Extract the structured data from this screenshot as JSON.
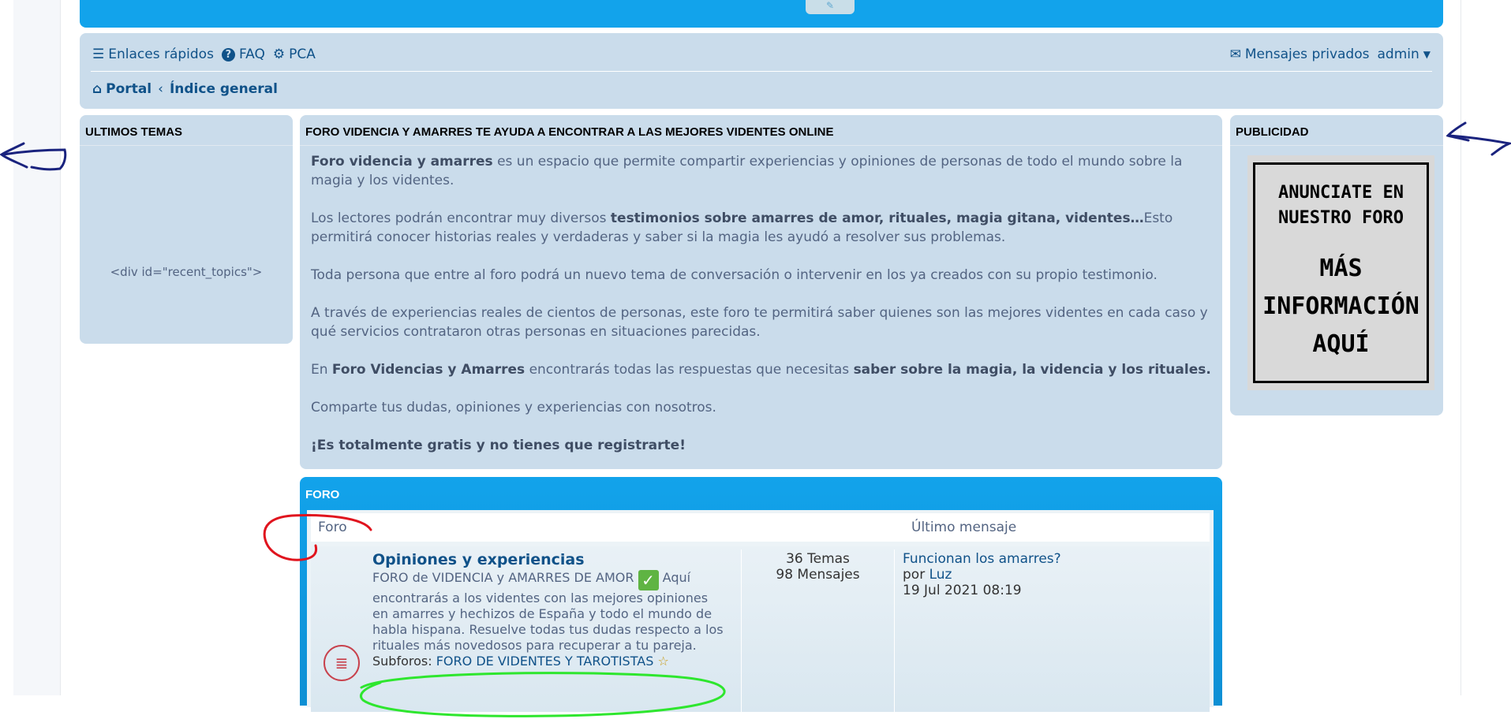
{
  "header": {
    "button_icon": "✎"
  },
  "navbar": {
    "quick_links": "Enlaces rápidos",
    "faq": "FAQ",
    "acp": "PCA",
    "private_messages": "Mensajes privados",
    "user": "admin",
    "breadcrumb_portal": "Portal",
    "breadcrumb_sep": "‹",
    "breadcrumb_index": "Índice general"
  },
  "left_panel": {
    "title": "ULTIMOS TEMAS",
    "content": "<div id=\"recent_topics\">"
  },
  "center_panel": {
    "title": "FORO VIDENCIA Y AMARRES TE AYUDA A ENCONTRAR A LAS MEJORES VIDENTES ONLINE",
    "p1_bold": "Foro videncia y amarres",
    "p1_rest": " es un espacio que permite compartir experiencias y opiniones de personas de todo el mundo sobre la magia y los videntes.",
    "p2_a": "Los lectores podrán encontrar muy diversos ",
    "p2_bold": "testimonios sobre amarres de amor, rituales, magia gitana, videntes…",
    "p2_b": "Esto permitirá conocer historias reales y verdaderas y saber si la magia les ayudó a resolver sus problemas.",
    "p3": "Toda persona que entre al foro podrá un nuevo tema de conversación o intervenir en los ya creados con su propio testimonio.",
    "p4": "A través de experiencias reales de cientos de personas, este foro te permitirá saber quienes son las mejores videntes en cada caso y qué servicios contrataron otras personas en situaciones parecidas.",
    "p5_a": "En ",
    "p5_bold1": "Foro Videncias y Amarres",
    "p5_b": " encontrarás todas las respuestas que necesitas ",
    "p5_bold2": "saber sobre la magia, la videncia y los rituales.",
    "p6": "Comparte tus dudas, opiniones y experiencias con nosotros.",
    "p7_bold": "¡Es totalmente gratis y no tienes que registrarte!"
  },
  "right_panel": {
    "title": "PUBLICIDAD",
    "ad_line1": "ANUNCIATE EN",
    "ad_line2": "NUESTRO FORO",
    "ad_line3": "MÁS",
    "ad_line4": "INFORMACIÓN",
    "ad_line5": "AQUÍ"
  },
  "forum": {
    "title": "FORO",
    "col_forum": "Foro",
    "col_last": "Último mensaje",
    "row": {
      "name": "Opiniones y experiencias",
      "desc_a": "FORO de VIDENCIA y AMARRES DE AMOR ",
      "desc_b": " Aquí encontrarás a los videntes con las mejores opiniones en amarres y hechizos de España y todo el mundo de habla hispana. Resuelve todas tus dudas respecto a los rituales más novedosos para recuperar a tu pareja.",
      "subforums_label": "Subforos:",
      "subforum": "FORO DE VIDENTES Y TAROTISTAS",
      "topics": "36 Temas",
      "posts": "98 Mensajes",
      "last_title": "Funcionan los amarres?",
      "last_by": "por",
      "last_user": "Luz",
      "last_date": "19 Jul 2021 08:19"
    }
  },
  "colors": {
    "header_blue": "#12a3eb",
    "panel_bg": "#cadceb",
    "link": "#105289",
    "annotation_blue": "#1a237e",
    "annotation_red": "#e0141e",
    "annotation_green": "#2ee62e"
  }
}
